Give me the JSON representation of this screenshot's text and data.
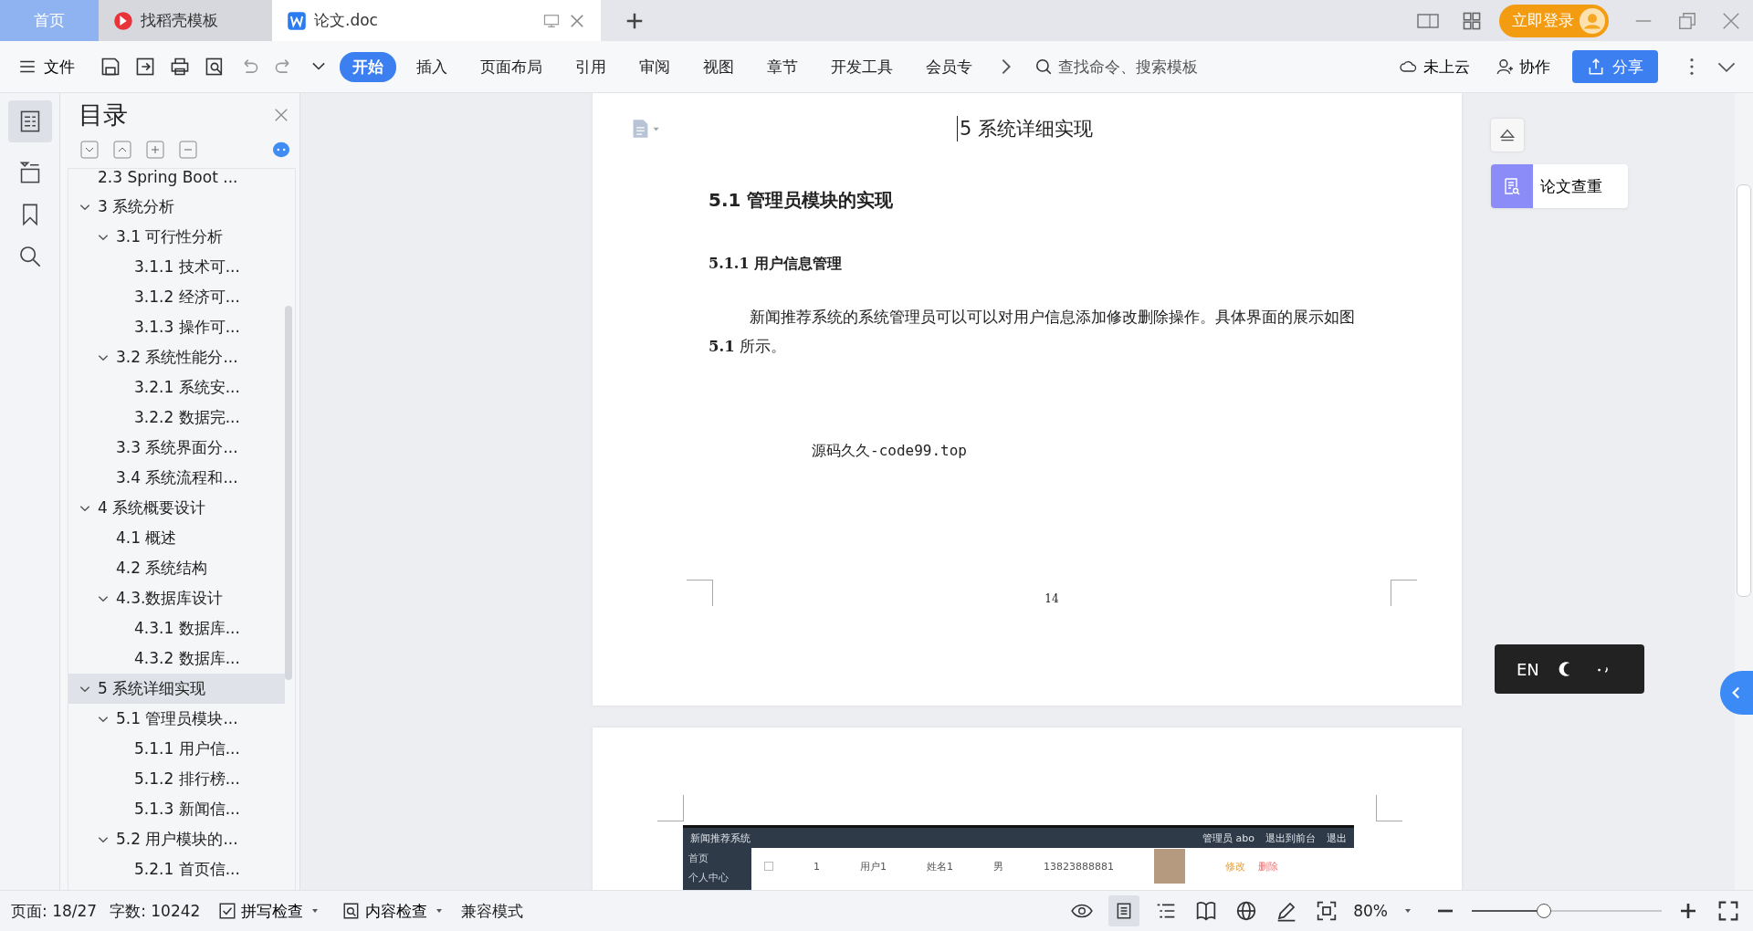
{
  "tabs": [
    {
      "label": "首页",
      "kind": "home",
      "selected": false
    },
    {
      "label": "找稻壳模板",
      "kind": "docer",
      "selected": false
    },
    {
      "label": "论文.doc",
      "kind": "doc",
      "selected": true
    }
  ],
  "login_button": "立即登录",
  "menu": {
    "file": "文件",
    "tabs": [
      {
        "label": "开始",
        "selected": true
      },
      {
        "label": "插入",
        "selected": false
      },
      {
        "label": "页面布局",
        "selected": false
      },
      {
        "label": "引用",
        "selected": false
      },
      {
        "label": "审阅",
        "selected": false
      },
      {
        "label": "视图",
        "selected": false
      },
      {
        "label": "章节",
        "selected": false
      },
      {
        "label": "开发工具",
        "selected": false
      },
      {
        "label": "会员专",
        "selected": false
      }
    ],
    "search": {
      "placeholder": "查找命令、搜索模板"
    },
    "cloud": "未上云",
    "collab": "协作",
    "share": "分享"
  },
  "toc": {
    "title": "目录",
    "items": [
      {
        "label": "2.3 Spring Boot ...",
        "selected": false
      },
      {
        "label": "3 系统分析",
        "selected": false,
        "expanded": true,
        "children": [
          {
            "label": "3.1 可行性分析",
            "selected": false,
            "expanded": true,
            "children": [
              {
                "label": "3.1.1 技术可...",
                "selected": false
              },
              {
                "label": "3.1.2 经济可...",
                "selected": false
              },
              {
                "label": "3.1.3 操作可...",
                "selected": false
              }
            ]
          },
          {
            "label": "3.2 系统性能分...",
            "selected": false,
            "expanded": true,
            "children": [
              {
                "label": "3.2.1  系统安...",
                "selected": false
              },
              {
                "label": "3.2.2  数据完...",
                "selected": false
              }
            ]
          },
          {
            "label": "3.3 系统界面分...",
            "selected": false
          },
          {
            "label": "3.4 系统流程和...",
            "selected": false
          }
        ]
      },
      {
        "label": "4 系统概要设计",
        "selected": false,
        "expanded": true,
        "children": [
          {
            "label": "4.1 概述",
            "selected": false
          },
          {
            "label": "4.2 系统结构",
            "selected": false
          },
          {
            "label": "4.3.数据库设计",
            "selected": false,
            "expanded": true,
            "children": [
              {
                "label": "4.3.1 数据库...",
                "selected": false
              },
              {
                "label": "4.3.2 数据库...",
                "selected": false
              }
            ]
          }
        ]
      },
      {
        "label": "5 系统详细实现",
        "selected": true,
        "expanded": true,
        "children": [
          {
            "label": "5.1  管理员模块...",
            "selected": false,
            "expanded": true,
            "children": [
              {
                "label": "5.1.1  用户信...",
                "selected": false
              },
              {
                "label": "5.1.2  排行榜...",
                "selected": false
              },
              {
                "label": "5.1.3  新闻信...",
                "selected": false
              }
            ]
          },
          {
            "label": "5.2 用户模块的...",
            "selected": false,
            "expanded": true,
            "children": [
              {
                "label": "5.2.1 首页信...",
                "selected": false
              }
            ]
          }
        ]
      }
    ]
  },
  "document": {
    "header": "5 系统详细实现",
    "heading": "5.1  管理员模块的实现",
    "subheading": "5.1.1  用户信息管理",
    "paragraph": "新闻推荐系统的系统管理员可以可以对用户信息添加修改删除操作。具体界面的展示如图 **5.1** 所示。",
    "source_note": "源码久久-code99.top",
    "page_number": "14",
    "screenshot": {
      "title": "新闻推荐系统",
      "checked": false,
      "links": [
        "管理员 abo",
        "退出到前台",
        "退出"
      ],
      "nav": [
        "首页",
        "个人中心"
      ],
      "row": [
        "1",
        "用户1",
        "姓名1",
        "男",
        "13823888881"
      ],
      "actions": [
        "修改",
        "删除"
      ]
    }
  },
  "side_panel": {
    "check_button": "论文查重",
    "ime": "EN"
  },
  "status_bar": {
    "page": "页面: 18/27",
    "words": "字数: 10242",
    "spell": "拼写检查",
    "content": "内容检查",
    "compat": "兼容模式",
    "zoom": "80%",
    "zoom_level": {
      "level": 0.38
    }
  }
}
